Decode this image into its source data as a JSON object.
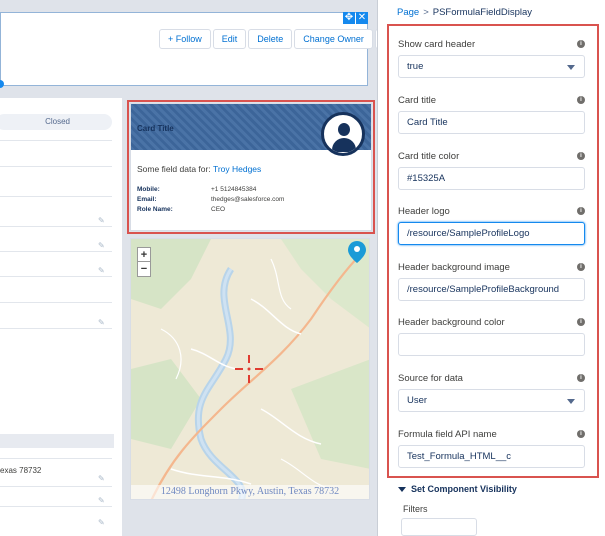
{
  "canvas": {
    "header_buttons": [
      "+ Follow",
      "Edit",
      "Delete",
      "Change Owner"
    ],
    "path_stage": "Closed",
    "address_fragment": "exas 78732"
  },
  "card": {
    "title": "Card Title",
    "field_prefix": "Some field data for:",
    "contact_name": "Troy Hedges",
    "details": [
      {
        "label": "Mobile:",
        "value": "+1 5124845384"
      },
      {
        "label": "Email:",
        "value": "thedges@salesforce.com"
      },
      {
        "label": "Role Name:",
        "value": "CEO"
      }
    ]
  },
  "map": {
    "zoom_in": "+",
    "zoom_out": "−",
    "address": "12498 Longhorn Pkwy, Austin, Texas 78732"
  },
  "panel": {
    "breadcrumb_link": "Page",
    "breadcrumb_sep": ">",
    "breadcrumb_current": "PSFormulaFieldDisplay",
    "props": [
      {
        "label": "Show card header",
        "value": "true",
        "type": "select"
      },
      {
        "label": "Card title",
        "value": "Card Title",
        "type": "text"
      },
      {
        "label": "Card title color",
        "value": "#15325A",
        "type": "text"
      },
      {
        "label": "Header logo",
        "value": "/resource/SampleProfileLogo",
        "type": "text",
        "focused": true
      },
      {
        "label": "Header background image",
        "value": "/resource/SampleProfileBackground",
        "type": "text"
      },
      {
        "label": "Header background color",
        "value": "",
        "type": "text"
      },
      {
        "label": "Source for data",
        "value": "User",
        "type": "select"
      },
      {
        "label": "Formula field API name",
        "value": "Test_Formula_HTML__c",
        "type": "text"
      }
    ],
    "visibility_section": "Set Component Visibility",
    "filters_label": "Filters"
  },
  "colors": {
    "highlight": "#d9534f",
    "link": "#0070d2",
    "card_header": "#3f6aa1",
    "card_title_color": "#15325A"
  }
}
